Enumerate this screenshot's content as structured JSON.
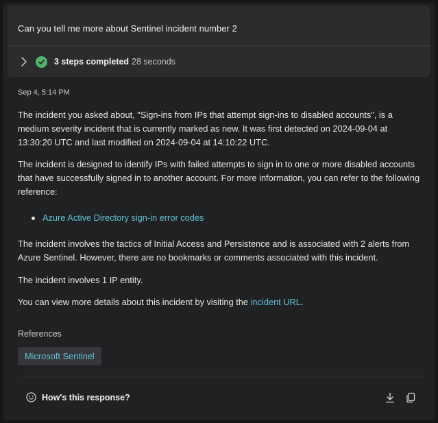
{
  "prompt": {
    "text": "Can you tell me more about Sentinel incident number 2"
  },
  "steps": {
    "label": "3 steps completed",
    "duration": "28 seconds",
    "status_color": "#4fb36b"
  },
  "response": {
    "timestamp": "Sep 4, 5:14 PM",
    "paragraph1": "The incident you asked about, \"Sign-ins from IPs that attempt sign-ins to disabled accounts\", is a medium severity incident that is currently marked as new. It was first detected on 2024-09-04 at 13:30:20 UTC and last modified on 2024-09-04 at 14:10:22 UTC.",
    "paragraph2": "The incident is designed to identify IPs with failed attempts to sign in to one or more disabled accounts that have successfully signed in to another account. For more information, you can refer to the following reference:",
    "bullet_link": "Azure Active Directory sign-in error codes",
    "paragraph3": "The incident involves the tactics of Initial Access and Persistence and is associated with 2 alerts from Azure Sentinel. However, there are no bookmarks or comments associated with this incident.",
    "paragraph4": "The incident involves 1 IP entity.",
    "paragraph5_prefix": "You can view more details about this incident by visiting the ",
    "paragraph5_link": "incident URL",
    "paragraph5_suffix": "."
  },
  "references": {
    "label": "References",
    "items": [
      "Microsoft Sentinel"
    ]
  },
  "footer": {
    "feedback_label": "How's this response?",
    "feedback_icon": "smiley-icon",
    "download_icon": "download-icon",
    "copy_icon": "copy-icon"
  },
  "colors": {
    "background": "#202123",
    "card": "#2b2c2e",
    "link": "#63c2d6"
  }
}
